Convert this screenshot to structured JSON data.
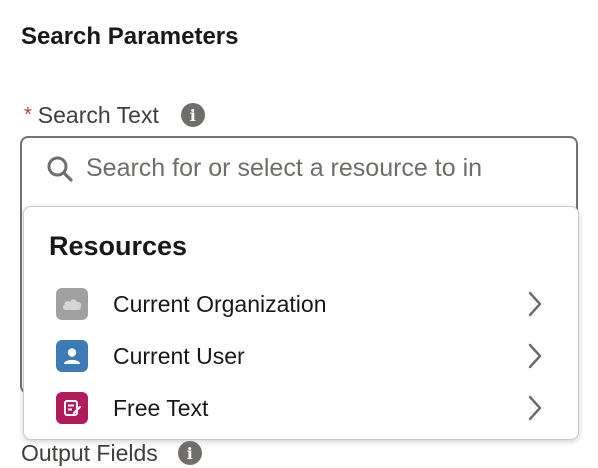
{
  "section": {
    "title": "Search Parameters"
  },
  "search_text_field": {
    "required_marker": "*",
    "label": "Search Text",
    "info_glyph": "i",
    "placeholder": "Search for or select a resource to in",
    "value": ""
  },
  "resources_dropdown": {
    "heading": "Resources",
    "items": [
      {
        "label": "Current Organization",
        "icon": "cloud-icon",
        "icon_bg": "#a0a0a0"
      },
      {
        "label": "Current User",
        "icon": "user-icon",
        "icon_bg": "#3c7bb5"
      },
      {
        "label": "Free Text",
        "icon": "text-template-icon",
        "icon_bg": "#b21b59"
      }
    ]
  },
  "output_fields": {
    "label": "Output Fields",
    "info_glyph": "i"
  },
  "colors": {
    "required": "#c23934",
    "info_icon": "#706e6b",
    "border": "#747474"
  }
}
